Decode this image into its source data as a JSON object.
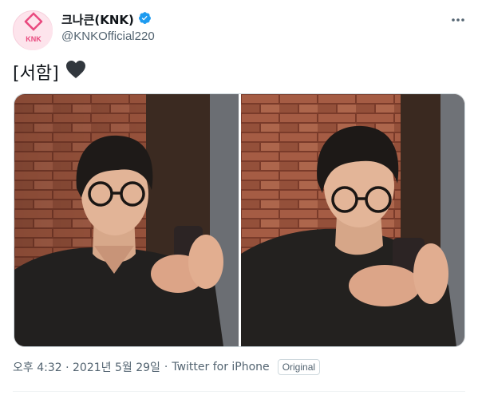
{
  "tweet": {
    "author_name": "크나큰(KNK)",
    "handle": "@KNKOfficial220",
    "avatar_text": "KNK",
    "text": "[서함]",
    "emoji": "black-heart",
    "timestamp": "오후 4:32 · 2021년 5월 29일",
    "source": "Twitter for iPhone",
    "badge": "Original",
    "media": [
      {
        "name": "photo-1",
        "description_icon": "photo"
      },
      {
        "name": "photo-2",
        "description_icon": "photo"
      }
    ]
  },
  "colors": {
    "verified": "#1d9bf0",
    "secondary_text": "#536471",
    "primary_text": "#0f1419",
    "brand_pink": "#e94a7f"
  },
  "icons": {
    "verified": "verified-badge-icon",
    "more": "more-options-icon",
    "heart": "black-heart-icon"
  }
}
